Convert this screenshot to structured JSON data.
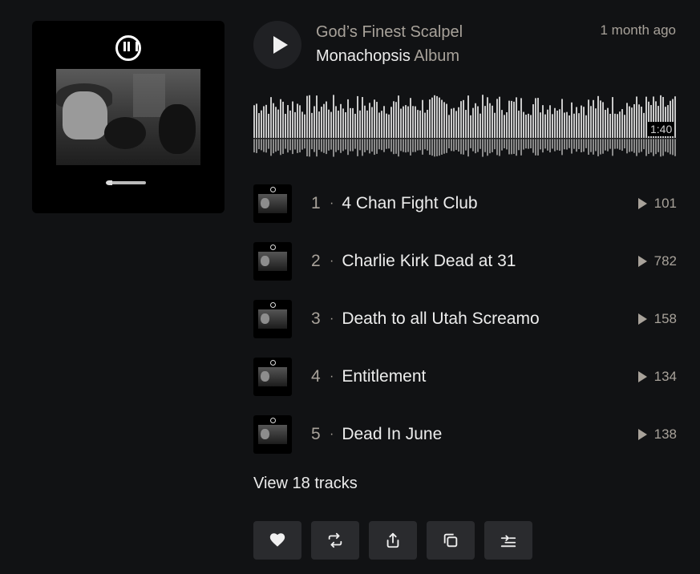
{
  "release": {
    "artist": "God’s Finest Scalpel",
    "title": "Monachopsis",
    "type": "Album",
    "posted": "1 month ago",
    "duration": "1:40"
  },
  "tracks": [
    {
      "number": "1",
      "separator": "·",
      "title": "4 Chan Fight Club",
      "plays": "101"
    },
    {
      "number": "2",
      "separator": "·",
      "title": "Charlie Kirk Dead at 31",
      "plays": "782"
    },
    {
      "number": "3",
      "separator": "·",
      "title": "Death to all Utah Screamo",
      "plays": "158"
    },
    {
      "number": "4",
      "separator": "·",
      "title": "Entitlement",
      "plays": "134"
    },
    {
      "number": "5",
      "separator": "·",
      "title": "Dead In June",
      "plays": "138"
    }
  ],
  "view_all_label": "View 18 tracks",
  "actions": [
    {
      "icon": "heart-icon",
      "name": "like-button"
    },
    {
      "icon": "repost-icon",
      "name": "repost-button"
    },
    {
      "icon": "share-icon",
      "name": "share-button"
    },
    {
      "icon": "copy-icon",
      "name": "copy-link-button"
    },
    {
      "icon": "add-to-queue-icon",
      "name": "add-to-queue-button"
    }
  ],
  "colors": {
    "background": "#111214",
    "muted_text": "#a8a29a",
    "primary_text": "#ececec",
    "button_bg": "#2a2b2e",
    "waveform": "#c9c9c9"
  }
}
